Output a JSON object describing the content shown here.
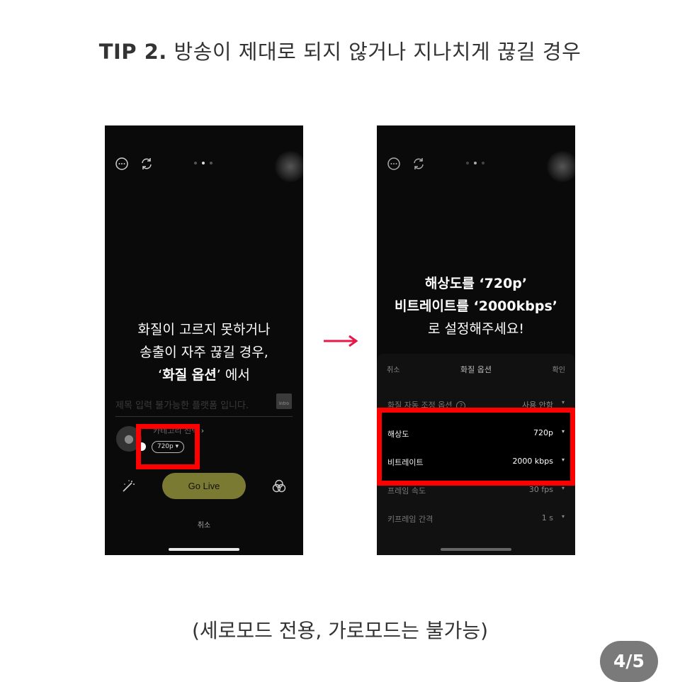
{
  "title": {
    "tip": "TIP 2.",
    "text": "방송이 제대로 되지 않거나 지나치게 끊길 경우"
  },
  "left_phone": {
    "overlay_line1": "화질이 고르지 못하거나",
    "overlay_line2": "송출이 자주 끊길 경우,",
    "overlay_quote_open": "‘",
    "overlay_bold": "화질 옵션",
    "overlay_quote_close": "’",
    "overlay_suffix": " 에서",
    "title_placeholder": "제목 입력 불가능한 플랫폼 입니다.",
    "intro_label": "Intro",
    "category_text": "카테고리 선택",
    "resolution_pill": "720p ▾",
    "go_live": "Go Live",
    "cancel": "취소",
    "icons": [
      "more-icon",
      "refresh-icon",
      "magic-wand-icon",
      "filter-icon",
      "user-icon"
    ]
  },
  "right_phone": {
    "overlay_line1_bold": "해상도",
    "overlay_line1_rest": "를 ‘720p’",
    "overlay_line2_bold": "비트레이트",
    "overlay_line2_rest": "를 ‘2000kbps’",
    "overlay_line3": "로 설정해주세요!",
    "sheet_cancel": "취소",
    "sheet_title": "화질 옵션",
    "sheet_ok": "확인",
    "auto_label": "화질 자동 조정 옵션",
    "auto_help": "?",
    "auto_value": "사용 안함",
    "resolution_label": "해상도",
    "resolution_value": "720p",
    "bitrate_label": "비트레이트",
    "bitrate_value": "2000 kbps",
    "framerate_label": "프레임 속도",
    "framerate_value": "30 fps",
    "keyframe_label": "키프레임 간격",
    "keyframe_value": "1 s",
    "caret": "▾"
  },
  "caption": "(세로모드 전용, 가로모드는 불가능)",
  "page": "4/5",
  "colors": {
    "highlight": "#ff0000",
    "go_live": "#7b7a32",
    "arrow": "#e6194b",
    "badge": "#7a7a7a"
  }
}
